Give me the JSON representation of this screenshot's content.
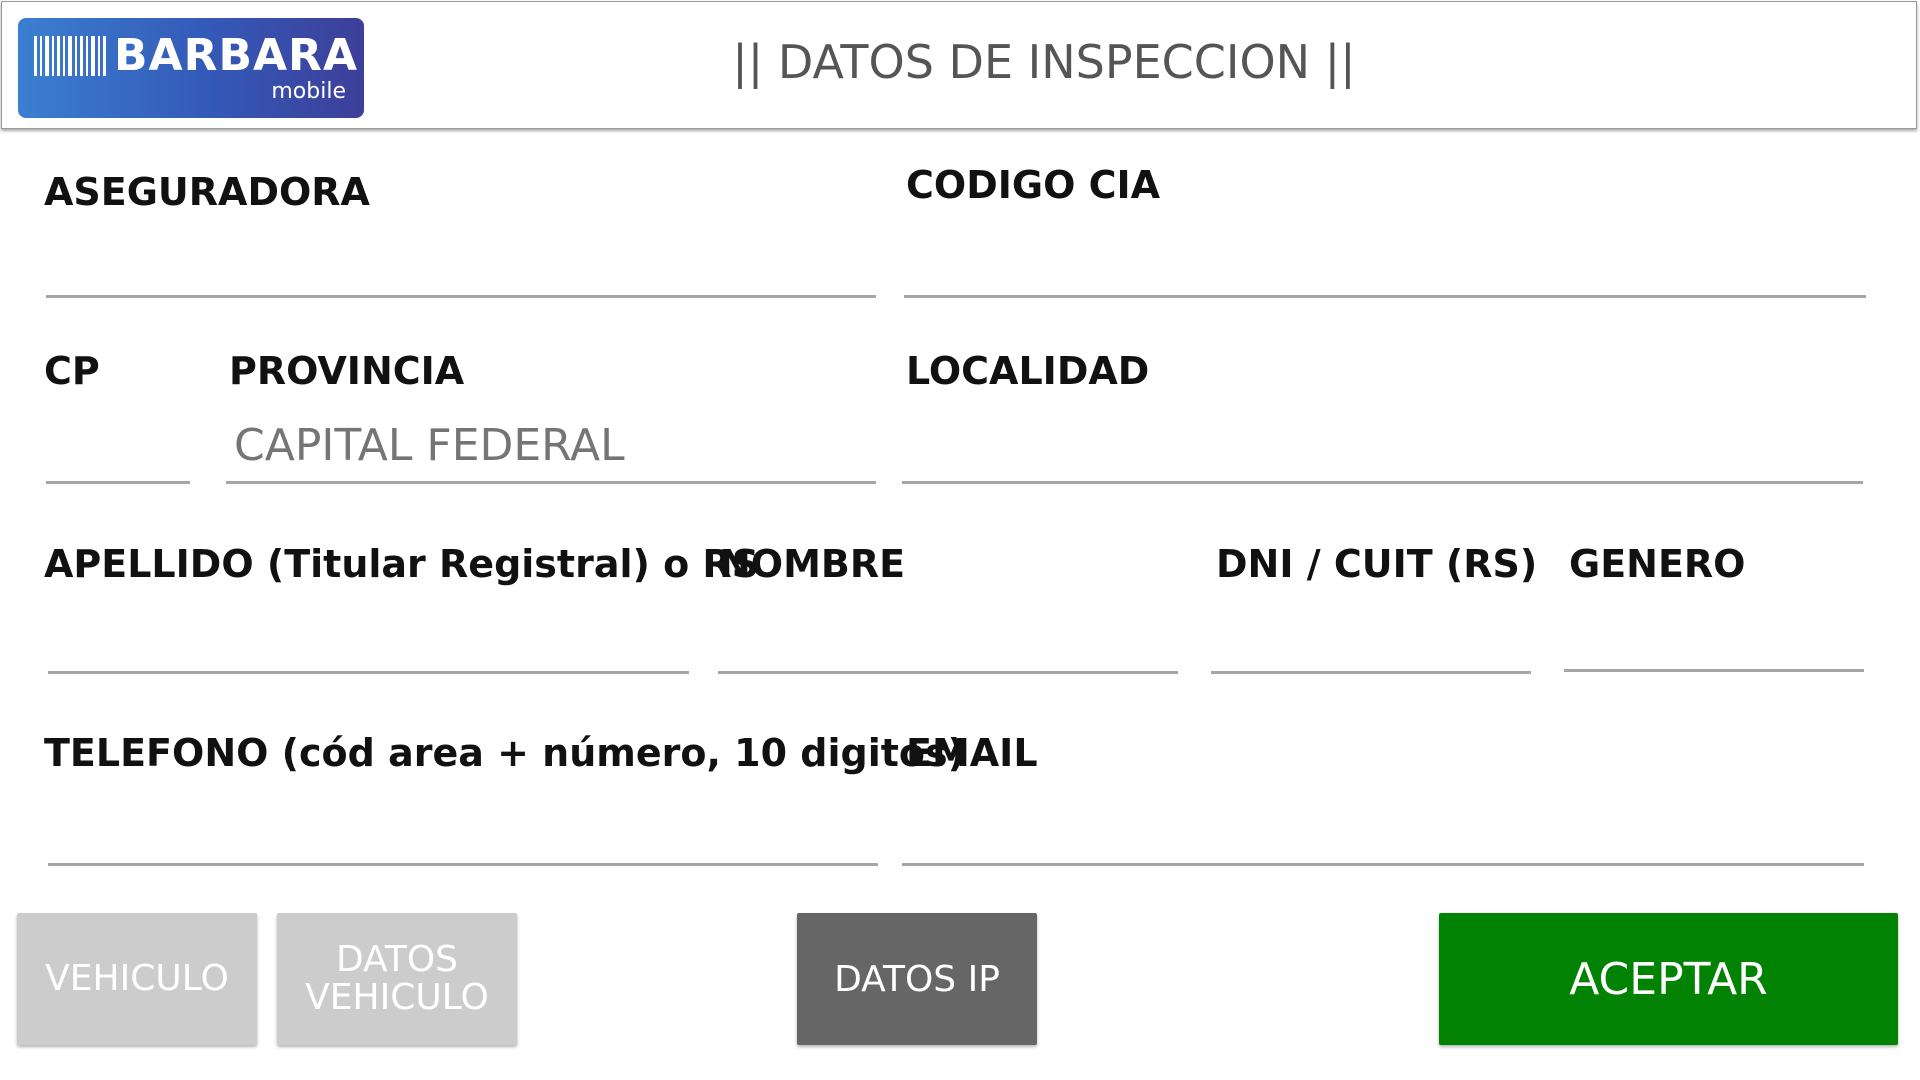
{
  "header": {
    "logo_text": "BARBARA",
    "logo_sub": "mobile",
    "title": "|| DATOS DE INSPECCION ||"
  },
  "form": {
    "aseguradora": {
      "label": "ASEGURADORA",
      "value": ""
    },
    "codigo_cia": {
      "label": "CODIGO CIA",
      "value": ""
    },
    "cp": {
      "label": "CP",
      "value": ""
    },
    "provincia": {
      "label": "PROVINCIA",
      "value": "CAPITAL FEDERAL"
    },
    "localidad": {
      "label": "LOCALIDAD",
      "value": ""
    },
    "apellido": {
      "label": "APELLIDO (Titular Registral) o RS",
      "value": ""
    },
    "nombre": {
      "label": "NOMBRE",
      "value": ""
    },
    "dni": {
      "label": "DNI / CUIT (RS)",
      "value": ""
    },
    "genero": {
      "label": "GENERO",
      "value": ""
    },
    "telefono": {
      "label": "TELEFONO (cód area + número, 10 digitos)",
      "value": ""
    },
    "email": {
      "label": "EMAIL",
      "value": ""
    }
  },
  "buttons": {
    "vehiculo": "VEHICULO",
    "datos_vehiculo_line1": "DATOS",
    "datos_vehiculo_line2": "VEHICULO",
    "datos_ip": "DATOS IP",
    "aceptar": "ACEPTAR"
  },
  "colors": {
    "accept": "#028202",
    "dark_button": "#666666",
    "disabled_button": "#cccccc",
    "underline": "#a6a6a6",
    "logo_gradient_start": "#3b7fd0",
    "logo_gradient_end": "#3d3f99"
  },
  "icons": {
    "logo_barcode": "barcode-icon"
  }
}
